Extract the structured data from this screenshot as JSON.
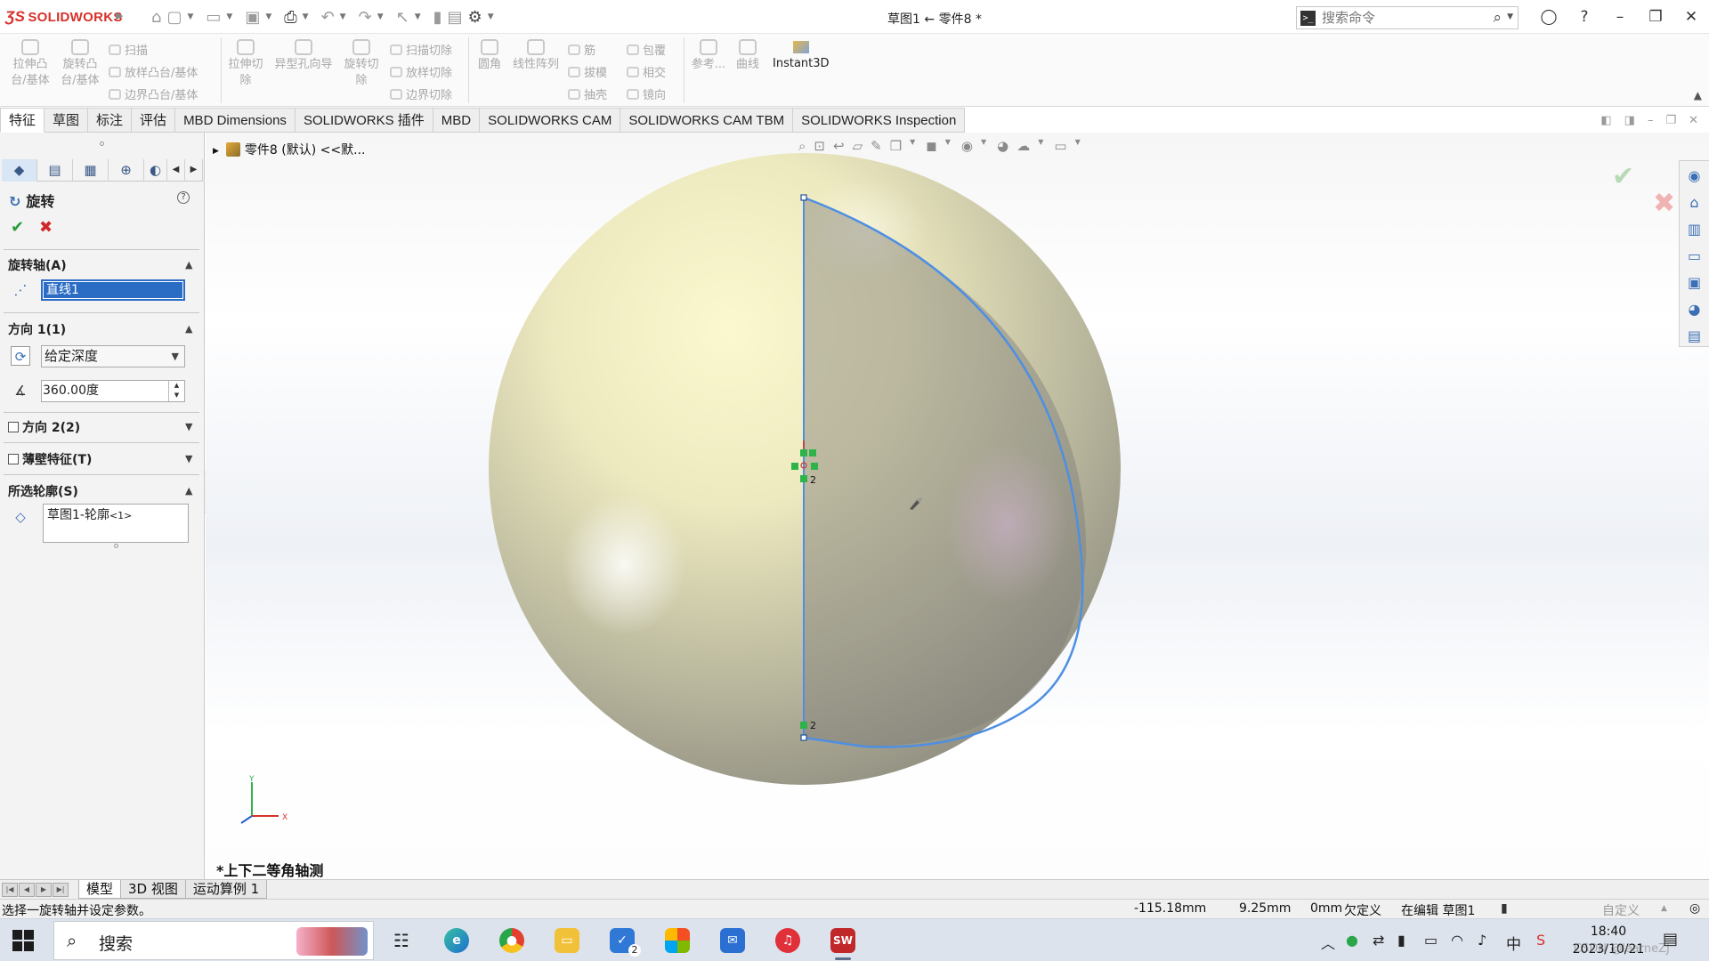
{
  "app": {
    "brand": "SOLIDWORKS",
    "document_title": "草图1 ← 零件8 *"
  },
  "search": {
    "placeholder": "搜索命令"
  },
  "ribbon": {
    "extrude_boss": "拉伸凸台/基体",
    "revolve_boss": "旋转凸台/基体",
    "sweep": "扫描",
    "loft": "放样凸台/基体",
    "boundary": "边界凸台/基体",
    "extrude_cut": "拉伸切除",
    "hole_wizard": "异型孔向导",
    "revolve_cut": "旋转切除",
    "sweep_cut": "扫描切除",
    "loft_cut": "放样切除",
    "boundary_cut": "边界切除",
    "fillet": "圆角",
    "linear_pattern": "线性阵列",
    "rib": "筋",
    "draft": "拔模",
    "shell": "抽壳",
    "wrap": "包覆",
    "intersect": "相交",
    "mirror": "镜向",
    "reference": "参考...",
    "curves": "曲线",
    "instant3d": "Instant3D"
  },
  "cm_tabs": [
    {
      "label": "特征",
      "active": true
    },
    {
      "label": "草图",
      "active": false
    },
    {
      "label": "标注",
      "active": false
    },
    {
      "label": "评估",
      "active": false
    },
    {
      "label": "MBD Dimensions",
      "active": false
    },
    {
      "label": "SOLIDWORKS 插件",
      "active": false
    },
    {
      "label": "MBD",
      "active": false
    },
    {
      "label": "SOLIDWORKS CAM",
      "active": false
    },
    {
      "label": "SOLIDWORKS CAM TBM",
      "active": false
    },
    {
      "label": "SOLIDWORKS Inspection",
      "active": false
    }
  ],
  "property_manager": {
    "title": "旋转",
    "help": "?",
    "axis_section": "旋转轴(A)",
    "axis_value": "直线1",
    "direction1_section": "方向 1(1)",
    "direction1_type": "给定深度",
    "direction1_angle": "360.00度",
    "direction2_section": "方向 2(2)",
    "thin_section": "薄壁特征(T)",
    "contours_section": "所选轮廓(S)",
    "contour_main": "草图1-轮廓",
    "contour_suffix": "<1>"
  },
  "viewport": {
    "tree_path": "零件8 (默认) <<默...",
    "view_orientation": "*上下二等角轴测",
    "relation_label_1": "2",
    "relation_label_2": "2",
    "axis_y": "Y",
    "axis_x": "X"
  },
  "bottom_tabs": [
    {
      "label": "模型",
      "active": true
    },
    {
      "label": "3D 视图",
      "active": false
    },
    {
      "label": "运动算例 1",
      "active": false
    }
  ],
  "status": {
    "message": "选择一旋转轴并设定参数。",
    "x": "-115.18mm",
    "y": "9.25mm",
    "z": "0mm",
    "definition": "欠定义",
    "editing": "在编辑 草图1",
    "units": "自定义"
  },
  "taskbar": {
    "search": "搜索",
    "time": "18:40",
    "date": "2023/10/21",
    "ime": "中",
    "watermark": "CSDN @learneZJ",
    "badge": "2"
  },
  "colors": {
    "sketch_blue": "#4d8fe3",
    "sphere_light": "#f3f0bf",
    "sphere_dark": "#8d8a80",
    "active_field": "#2b6cc4",
    "brand_red": "#d6322a",
    "ok_green": "#2a9d3a",
    "cancel_red": "#d0282a"
  }
}
